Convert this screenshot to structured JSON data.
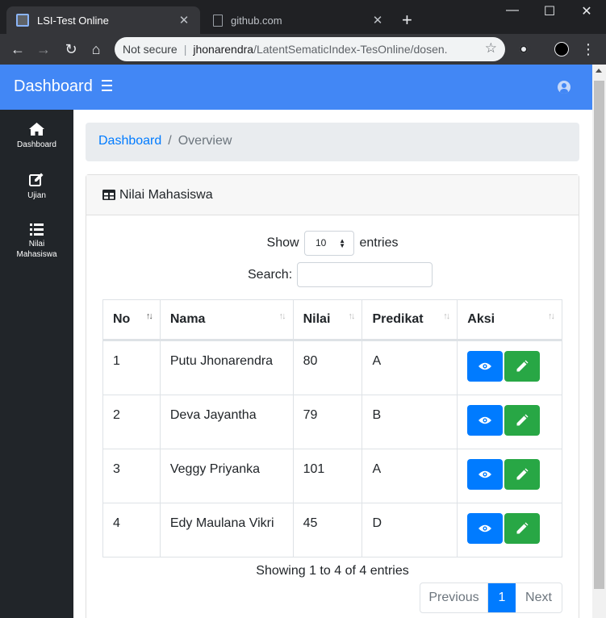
{
  "browser": {
    "tabs": [
      {
        "title": "LSI-Test Online",
        "active": true
      },
      {
        "title": "github.com",
        "active": false
      }
    ],
    "new_tab": "+",
    "window_controls": {
      "minimize": "—",
      "maximize": "☐",
      "close": "✕"
    },
    "omnibox": {
      "security": "Not secure",
      "host": "jhonarendra",
      "path": "/LatentSematicIndex-TesOnline/dosen..."
    }
  },
  "app": {
    "brand": "Dashboard",
    "accent_color": "#4287f5",
    "sidebar": {
      "items": [
        {
          "label": "Dashboard",
          "icon": "home-icon"
        },
        {
          "label": "Ujian",
          "icon": "edit-icon"
        },
        {
          "label": "Nilai Mahasiswa",
          "icon": "list-icon"
        }
      ]
    },
    "breadcrumb": {
      "link": "Dashboard",
      "divider": "/",
      "current": "Overview"
    },
    "card": {
      "title": "Nilai Mahasiswa",
      "length": {
        "before": "Show",
        "value": "10",
        "after": "entries"
      },
      "search_label": "Search:",
      "table": {
        "columns": [
          "No",
          "Nama",
          "Nilai",
          "Predikat",
          "Aksi"
        ],
        "rows": [
          {
            "no": "1",
            "nama": "Putu Jhonarendra",
            "nilai": "80",
            "predikat": "A"
          },
          {
            "no": "2",
            "nama": "Deva Jayantha",
            "nilai": "79",
            "predikat": "B"
          },
          {
            "no": "3",
            "nama": "Veggy Priyanka",
            "nilai": "101",
            "predikat": "A"
          },
          {
            "no": "4",
            "nama": "Edy Maulana Vikri",
            "nilai": "45",
            "predikat": "D"
          }
        ]
      },
      "info": "Showing 1 to 4 of 4 entries",
      "pagination": {
        "previous": "Previous",
        "current": "1",
        "next": "Next"
      }
    }
  }
}
